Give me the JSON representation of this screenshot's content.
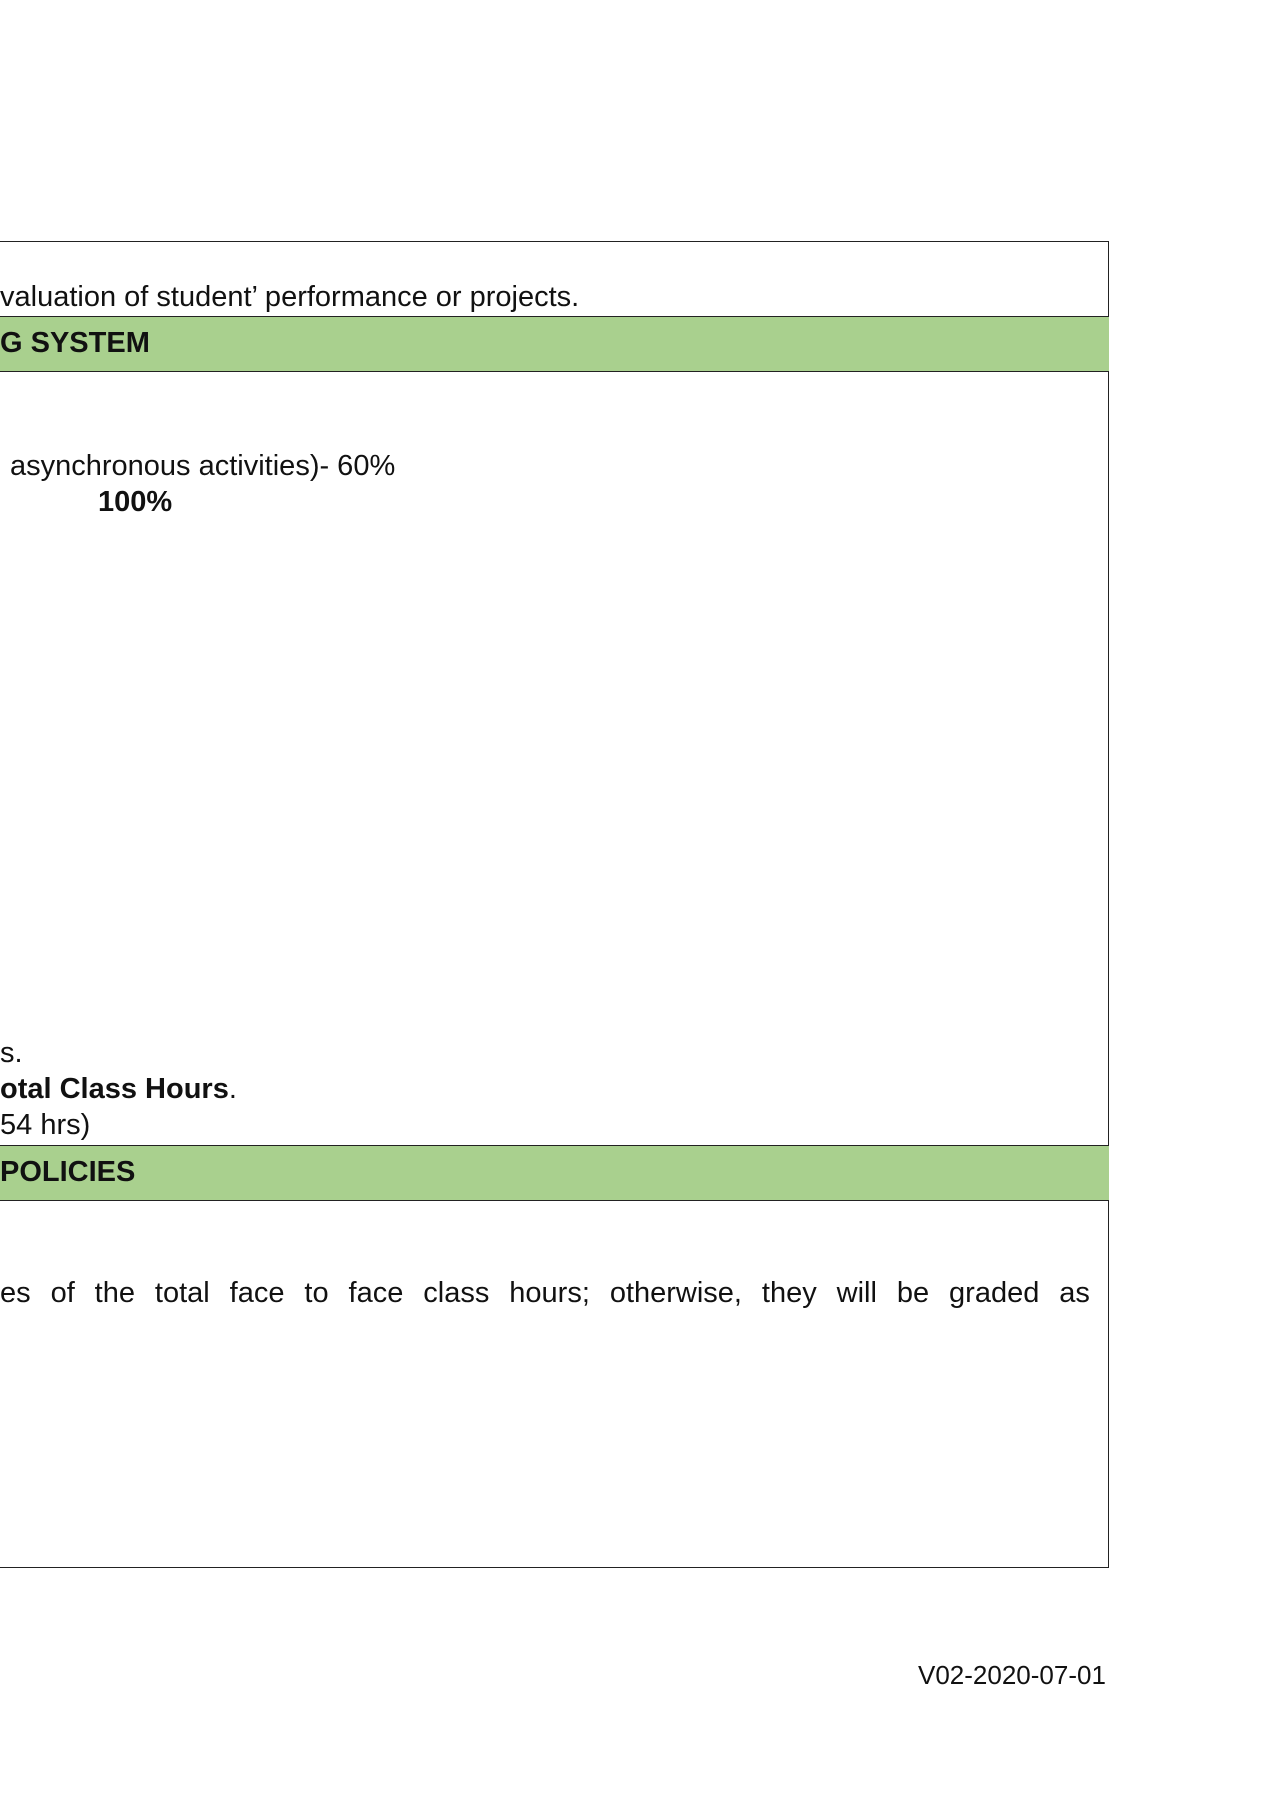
{
  "evaluation": {
    "line": "valuation of student’ performance or projects."
  },
  "grading": {
    "header": "G SYSTEM",
    "line_async": "asynchronous activities)-  60%",
    "total": "100%"
  },
  "attendance": {
    "line_1": "s.",
    "line_2_bold": "otal Class Hours",
    "line_2_tail": ".",
    "line_3": "54 hrs)"
  },
  "policies": {
    "header": "POLICIES",
    "paragraph_words": [
      "es",
      "of",
      "the",
      "total",
      "face",
      "to",
      "face",
      "class",
      "hours;",
      "otherwise,",
      "they",
      "will",
      "be",
      "graded",
      "as"
    ]
  },
  "footer": {
    "version": "V02-2020-07-01"
  }
}
